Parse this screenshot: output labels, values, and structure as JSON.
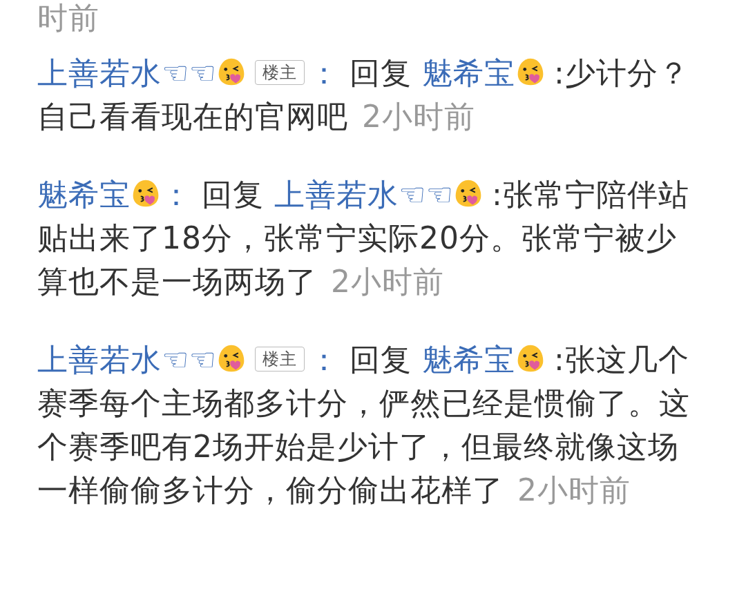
{
  "previous_time": "时前",
  "comments": [
    {
      "author": {
        "name": "上善若水",
        "decoration": "☜☜",
        "emoji": true
      },
      "badge": "楼主",
      "colon": "：",
      "reply_word": "回复",
      "reply_to": {
        "name": "魅希宝",
        "emoji": true
      },
      "text": ":少计分？自己看看现在的官网吧",
      "time": "2小时前"
    },
    {
      "author": {
        "name": "魅希宝",
        "emoji": true
      },
      "colon": "：",
      "reply_word": "回复",
      "reply_to": {
        "name": "上善若水",
        "decoration": "☜☜",
        "emoji": true
      },
      "text": ":张常宁陪伴站贴出来了18分，张常宁实际20分。张常宁被少算也不是一场两场了",
      "time": "2小时前"
    },
    {
      "author": {
        "name": "上善若水",
        "decoration": "☜☜",
        "emoji": true
      },
      "badge": "楼主",
      "colon": "：",
      "reply_word": "回复",
      "reply_to": {
        "name": "魅希宝",
        "emoji": true
      },
      "text": ":张这几个赛季每个主场都多计分，俨然已经是惯偷了。这个赛季吧有2场开始是少计了，但最终就像这场一样偷偷多计分，偷分偷出花样了",
      "time": "2小时前"
    }
  ]
}
